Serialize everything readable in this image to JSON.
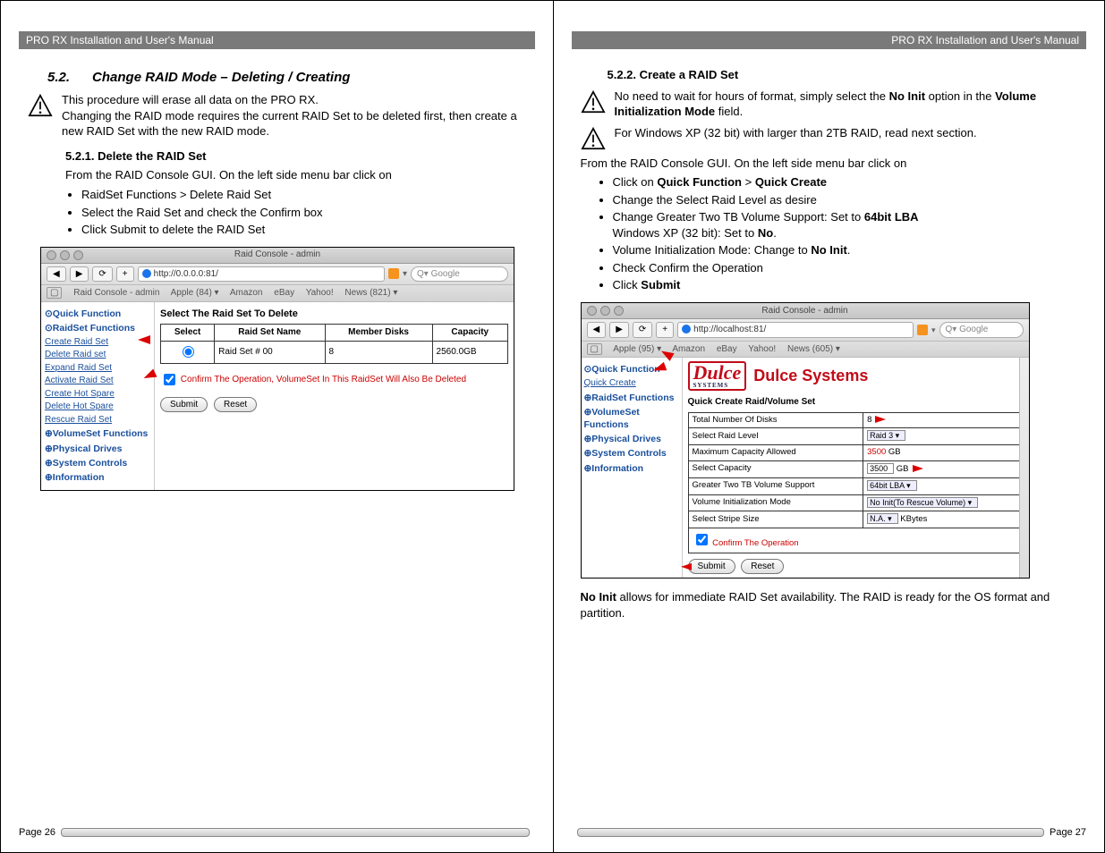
{
  "manual_title": "PRO RX Installation and User's Manual",
  "left": {
    "sec_num": "5.2.",
    "sec_title": "Change RAID Mode – Deleting / Creating",
    "warn1_l1": "This procedure will erase all data on the PRO RX.",
    "warn1_l2": "Changing the RAID mode requires the current RAID Set to be deleted first, then create a new RAID Set with the new RAID mode.",
    "subsec": "5.2.1. Delete the RAID Set",
    "para1": "From the RAID Console GUI.  On the left side menu bar click on",
    "bullets": [
      "RaidSet Functions > Delete Raid Set",
      "Select the Raid Set and check the Confirm box",
      "Click Submit to delete the RAID Set"
    ],
    "shot": {
      "window_title": "Raid Console - admin",
      "url": "http://0.0.0.0:81/",
      "search_placeholder": "Q▾ Google",
      "bookmarks": [
        "Raid Console - admin",
        "Apple (84) ▾",
        "Amazon",
        "eBay",
        "Yahoo!",
        "News (821) ▾"
      ],
      "sb_quick": "⊙Quick Function",
      "sb_raidset": "⊙RaidSet Functions",
      "sb_items": [
        "Create Raid Set",
        "Delete Raid set",
        "Expand Raid Set",
        "Activate Raid Set",
        "Create Hot Spare",
        "Delete Hot Spare",
        "Rescue Raid Set"
      ],
      "sb_vol": "⊕VolumeSet Functions",
      "sb_phys": "⊕Physical Drives",
      "sb_sys": "⊕System Controls",
      "sb_info": "⊕Information",
      "main_heading": "Select The Raid Set To Delete",
      "th": [
        "Select",
        "Raid Set Name",
        "Member Disks",
        "Capacity"
      ],
      "row": {
        "name": "Raid Set # 00",
        "disks": "8",
        "capacity": "2560.0GB"
      },
      "confirm": "Confirm The Operation, VolumeSet In This RaidSet Will Also Be Deleted",
      "btn_submit": "Submit",
      "btn_reset": "Reset"
    },
    "page_num": "Page 26"
  },
  "right": {
    "subsec": "5.2.2. Create a RAID Set",
    "warn1_a": "No need to wait for hours of format, simply select the ",
    "warn1_b": "No Init",
    "warn1_c": " option in the ",
    "warn1_d": "Volume Initialization Mode",
    "warn1_e": " field.",
    "warn2": "For Windows XP (32 bit) with larger than 2TB RAID, read next section.",
    "para1": "From the RAID Console GUI.  On the left side menu bar click on",
    "b1a": "Click on ",
    "b1b": "Quick Function",
    "b1c": " > ",
    "b1d": "Quick Create",
    "b2": "Change the Select Raid Level as desire",
    "b3a": "Change Greater Two TB Volume Support: Set to ",
    "b3b": "64bit LBA",
    "b3c": "Windows XP (32 bit): Set to ",
    "b3d": "No",
    "b3e": ".",
    "b4a": "Volume Initialization Mode: Change to ",
    "b4b": "No Init",
    "b4c": ".",
    "b5": "Check Confirm the Operation",
    "b6a": "Click ",
    "b6b": "Submit",
    "shot": {
      "window_title": "Raid Console - admin",
      "url": "http://localhost:81/",
      "search_placeholder": "Q▾ Google",
      "bookmarks": [
        "Apple (95) ▾",
        "Amazon",
        "eBay",
        "Yahoo!",
        "News (605) ▾"
      ],
      "sb_quick": "⊙Quick Function",
      "sb_quick_item": "Quick Create",
      "sb_raidset": "⊕RaidSet Functions",
      "sb_vol": "⊕VolumeSet Functions",
      "sb_phys": "⊕Physical Drives",
      "sb_sys": "⊕System Controls",
      "sb_info": "⊕Information",
      "logo_text": "Dulce",
      "logo_sub": "SYSTEMS",
      "logo_title": "Dulce Systems",
      "main_heading": "Quick Create Raid/Volume Set",
      "rows": [
        {
          "label": "Total Number Of Disks",
          "value": "8"
        },
        {
          "label": "Select Raid Level",
          "value": "Raid 3"
        },
        {
          "label": "Maximum Capacity Allowed",
          "value": "3500",
          "suffix": " GB"
        },
        {
          "label": "Select Capacity",
          "value": "3500",
          "suffix": " GB"
        },
        {
          "label": "Greater Two TB Volume Support",
          "value": "64bit LBA"
        },
        {
          "label": "Volume Initialization Mode",
          "value": "No Init(To Rescue Volume)"
        },
        {
          "label": "Select Stripe Size",
          "value": "N.A.",
          "suffix": " KBytes"
        }
      ],
      "confirm": "Confirm The Operation",
      "btn_submit": "Submit",
      "btn_reset": "Reset"
    },
    "closing_a": "No Init",
    "closing_b": " allows for immediate RAID Set availability.  The RAID is ready for the OS format and partition.",
    "page_num": "Page 27"
  }
}
